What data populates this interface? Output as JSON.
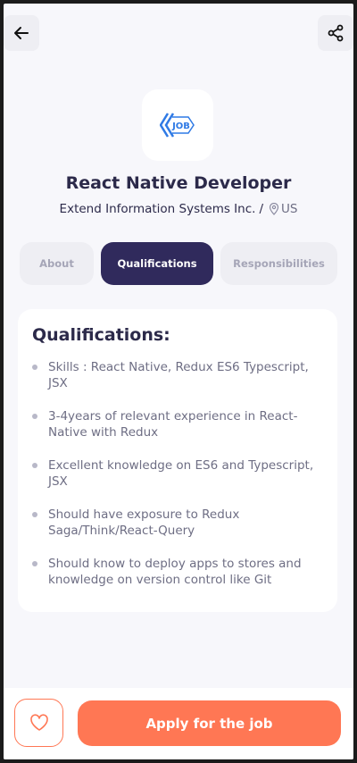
{
  "header": {
    "back_icon": "arrow-left-icon",
    "share_icon": "share-icon"
  },
  "job": {
    "logo_text": "JOB",
    "title": "React Native Developer",
    "company": "Extend Information Systems Inc.",
    "separator": "/",
    "location": "US",
    "location_icon": "location-pin-icon"
  },
  "tabs": [
    {
      "label": "About",
      "active": false
    },
    {
      "label": "Qualifications",
      "active": true
    },
    {
      "label": "Responsibilities",
      "active": false
    }
  ],
  "qualifications": {
    "title": "Qualifications:",
    "items": [
      "Skills : React Native, Redux ES6 Typescript, JSX",
      "3-4years of relevant experience in React-Native with Redux",
      "Excellent knowledge on ES6 and Typescript, JSX",
      "Should have exposure to Redux Saga/Think/React-Query",
      "Should know to deploy apps to stores and knowledge on version control like Git"
    ]
  },
  "footer": {
    "favorite_icon": "heart-icon",
    "apply_label": "Apply for the job"
  },
  "colors": {
    "accent": "#ff7754",
    "primary": "#302a5c",
    "text_dark": "#2c2a4a",
    "text_muted": "#6e6e84",
    "logo_blue": "#2f7ae5"
  }
}
